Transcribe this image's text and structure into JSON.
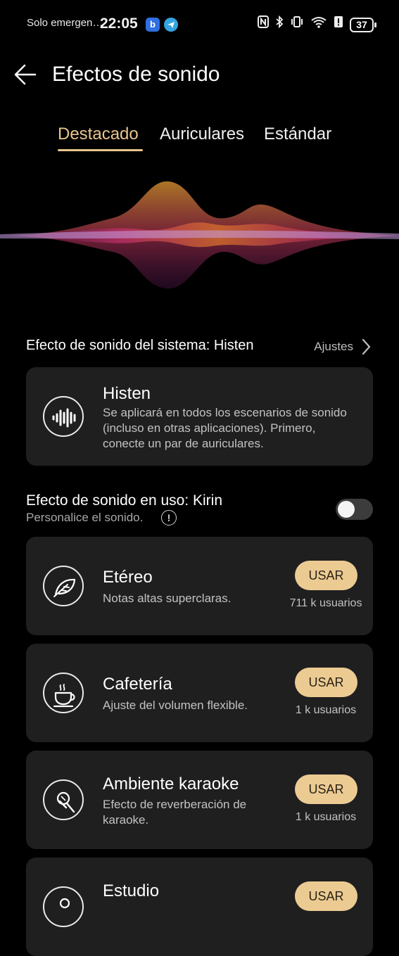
{
  "status_bar": {
    "carrier": "Solo emergen…",
    "time": "22:05",
    "battery": "37"
  },
  "header": {
    "title": "Efectos de sonido"
  },
  "tabs": [
    {
      "label": "Destacado"
    },
    {
      "label": "Auriculares"
    },
    {
      "label": "Estándar"
    }
  ],
  "system_effect": {
    "label": "Efecto de sonido del sistema: Histen",
    "link": "Ajustes",
    "card": {
      "title": "Histen",
      "desc": "Se aplicará en todos los escenarios de sonido (incluso en otras aplicaciones). Primero, conecte un par de auriculares.",
      "icon": "sound-wave-icon"
    }
  },
  "in_use": {
    "label": "Efecto de sonido en uso: Kirin",
    "sub": "Personalice el sonido.",
    "toggle_on": false
  },
  "effects": [
    {
      "title": "Etéreo",
      "desc": "Notas altas superclaras.",
      "button": "USAR",
      "users": "711 k usuarios",
      "icon": "feather-icon"
    },
    {
      "title": "Cafetería",
      "desc": "Ajuste del volumen flexible.",
      "button": "USAR",
      "users": "1 k usuarios",
      "icon": "coffee-cup-icon"
    },
    {
      "title": "Ambiente karaoke",
      "desc": "Efecto de reverberación de karaoke.",
      "button": "USAR",
      "users": "1 k usuarios",
      "icon": "microphone-icon"
    },
    {
      "title": "Estudio",
      "desc": "",
      "button": "USAR",
      "users": "",
      "icon": "studio-icon"
    }
  ],
  "colors": {
    "accent": "#e9c48d",
    "button": "#eccb93",
    "card": "#1f1f1f",
    "background": "#000000"
  }
}
